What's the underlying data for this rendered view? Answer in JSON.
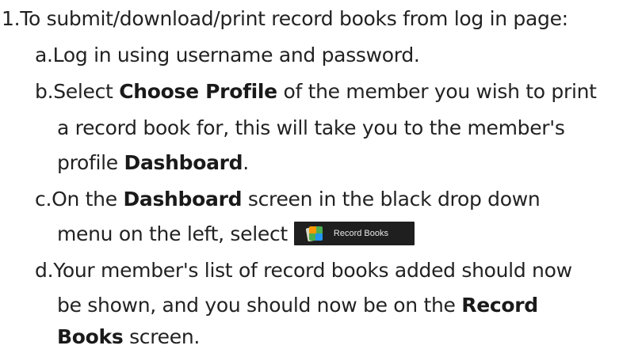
{
  "step1": {
    "number": "1.",
    "text": "To submit/download/print record books from log in page:"
  },
  "step_a": {
    "letter": "a.",
    "text": "Log in using username and password."
  },
  "step_b": {
    "letter": "b.",
    "pre": "Select ",
    "bold1": "Choose Profile",
    "post1": " of the member you wish to print",
    "line2": "a record book for, this will take you to the member's",
    "line3_pre": "profile ",
    "bold2": "Dashboard",
    "line3_post": "."
  },
  "step_c": {
    "letter": "c.",
    "pre": "On the ",
    "bold1": "Dashboard",
    "post1": " screen in the black drop down",
    "line2": "menu on the left, select",
    "button": {
      "icon": "record-books-icon",
      "label": "Record Books"
    }
  },
  "step_d": {
    "letter": "d.",
    "line1": "Your member's list of record books added should now",
    "line2_pre": "be shown, and you should now be on the ",
    "bold1": "Record",
    "bold2": "Books",
    "line3_post": " screen."
  }
}
